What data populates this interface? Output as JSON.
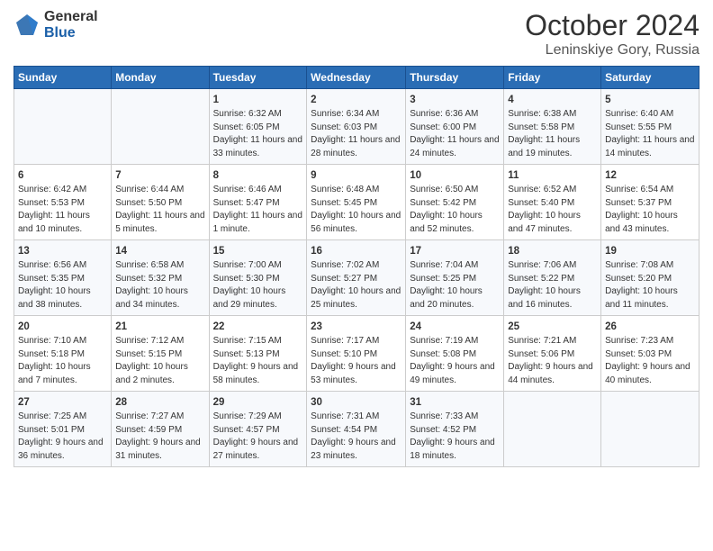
{
  "header": {
    "logo_general": "General",
    "logo_blue": "Blue",
    "month_title": "October 2024",
    "location": "Leninskiye Gory, Russia"
  },
  "weekdays": [
    "Sunday",
    "Monday",
    "Tuesday",
    "Wednesday",
    "Thursday",
    "Friday",
    "Saturday"
  ],
  "weeks": [
    [
      {
        "day": "",
        "info": ""
      },
      {
        "day": "",
        "info": ""
      },
      {
        "day": "1",
        "info": "Sunrise: 6:32 AM\nSunset: 6:05 PM\nDaylight: 11 hours and 33 minutes."
      },
      {
        "day": "2",
        "info": "Sunrise: 6:34 AM\nSunset: 6:03 PM\nDaylight: 11 hours and 28 minutes."
      },
      {
        "day": "3",
        "info": "Sunrise: 6:36 AM\nSunset: 6:00 PM\nDaylight: 11 hours and 24 minutes."
      },
      {
        "day": "4",
        "info": "Sunrise: 6:38 AM\nSunset: 5:58 PM\nDaylight: 11 hours and 19 minutes."
      },
      {
        "day": "5",
        "info": "Sunrise: 6:40 AM\nSunset: 5:55 PM\nDaylight: 11 hours and 14 minutes."
      }
    ],
    [
      {
        "day": "6",
        "info": "Sunrise: 6:42 AM\nSunset: 5:53 PM\nDaylight: 11 hours and 10 minutes."
      },
      {
        "day": "7",
        "info": "Sunrise: 6:44 AM\nSunset: 5:50 PM\nDaylight: 11 hours and 5 minutes."
      },
      {
        "day": "8",
        "info": "Sunrise: 6:46 AM\nSunset: 5:47 PM\nDaylight: 11 hours and 1 minute."
      },
      {
        "day": "9",
        "info": "Sunrise: 6:48 AM\nSunset: 5:45 PM\nDaylight: 10 hours and 56 minutes."
      },
      {
        "day": "10",
        "info": "Sunrise: 6:50 AM\nSunset: 5:42 PM\nDaylight: 10 hours and 52 minutes."
      },
      {
        "day": "11",
        "info": "Sunrise: 6:52 AM\nSunset: 5:40 PM\nDaylight: 10 hours and 47 minutes."
      },
      {
        "day": "12",
        "info": "Sunrise: 6:54 AM\nSunset: 5:37 PM\nDaylight: 10 hours and 43 minutes."
      }
    ],
    [
      {
        "day": "13",
        "info": "Sunrise: 6:56 AM\nSunset: 5:35 PM\nDaylight: 10 hours and 38 minutes."
      },
      {
        "day": "14",
        "info": "Sunrise: 6:58 AM\nSunset: 5:32 PM\nDaylight: 10 hours and 34 minutes."
      },
      {
        "day": "15",
        "info": "Sunrise: 7:00 AM\nSunset: 5:30 PM\nDaylight: 10 hours and 29 minutes."
      },
      {
        "day": "16",
        "info": "Sunrise: 7:02 AM\nSunset: 5:27 PM\nDaylight: 10 hours and 25 minutes."
      },
      {
        "day": "17",
        "info": "Sunrise: 7:04 AM\nSunset: 5:25 PM\nDaylight: 10 hours and 20 minutes."
      },
      {
        "day": "18",
        "info": "Sunrise: 7:06 AM\nSunset: 5:22 PM\nDaylight: 10 hours and 16 minutes."
      },
      {
        "day": "19",
        "info": "Sunrise: 7:08 AM\nSunset: 5:20 PM\nDaylight: 10 hours and 11 minutes."
      }
    ],
    [
      {
        "day": "20",
        "info": "Sunrise: 7:10 AM\nSunset: 5:18 PM\nDaylight: 10 hours and 7 minutes."
      },
      {
        "day": "21",
        "info": "Sunrise: 7:12 AM\nSunset: 5:15 PM\nDaylight: 10 hours and 2 minutes."
      },
      {
        "day": "22",
        "info": "Sunrise: 7:15 AM\nSunset: 5:13 PM\nDaylight: 9 hours and 58 minutes."
      },
      {
        "day": "23",
        "info": "Sunrise: 7:17 AM\nSunset: 5:10 PM\nDaylight: 9 hours and 53 minutes."
      },
      {
        "day": "24",
        "info": "Sunrise: 7:19 AM\nSunset: 5:08 PM\nDaylight: 9 hours and 49 minutes."
      },
      {
        "day": "25",
        "info": "Sunrise: 7:21 AM\nSunset: 5:06 PM\nDaylight: 9 hours and 44 minutes."
      },
      {
        "day": "26",
        "info": "Sunrise: 7:23 AM\nSunset: 5:03 PM\nDaylight: 9 hours and 40 minutes."
      }
    ],
    [
      {
        "day": "27",
        "info": "Sunrise: 7:25 AM\nSunset: 5:01 PM\nDaylight: 9 hours and 36 minutes."
      },
      {
        "day": "28",
        "info": "Sunrise: 7:27 AM\nSunset: 4:59 PM\nDaylight: 9 hours and 31 minutes."
      },
      {
        "day": "29",
        "info": "Sunrise: 7:29 AM\nSunset: 4:57 PM\nDaylight: 9 hours and 27 minutes."
      },
      {
        "day": "30",
        "info": "Sunrise: 7:31 AM\nSunset: 4:54 PM\nDaylight: 9 hours and 23 minutes."
      },
      {
        "day": "31",
        "info": "Sunrise: 7:33 AM\nSunset: 4:52 PM\nDaylight: 9 hours and 18 minutes."
      },
      {
        "day": "",
        "info": ""
      },
      {
        "day": "",
        "info": ""
      }
    ]
  ]
}
